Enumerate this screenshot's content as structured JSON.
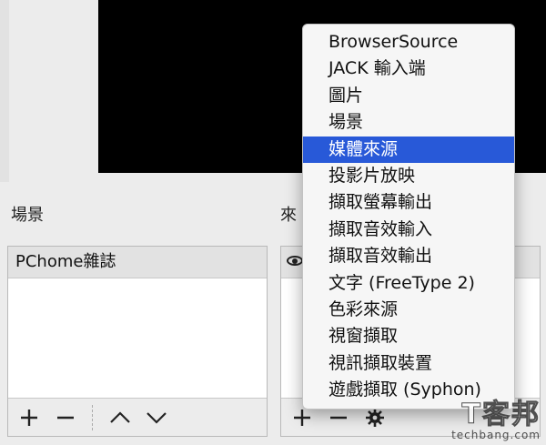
{
  "scenes": {
    "title": "場景",
    "items": [
      "PChome雜誌"
    ]
  },
  "sources": {
    "title_partial": "來",
    "toolbar": {}
  },
  "context_menu": {
    "items": [
      "BrowserSource",
      "JACK 輸入端",
      "圖片",
      "場景",
      "媒體來源",
      "投影片放映",
      "擷取螢幕輸出",
      "擷取音效輸入",
      "擷取音效輸出",
      "文字 (FreeType 2)",
      "色彩來源",
      "視窗擷取",
      "視訊擷取裝置",
      "遊戲擷取 (Syphon)"
    ],
    "selected_index": 4
  },
  "watermark": {
    "big": "T客邦",
    "small": "techbang.com"
  },
  "icons": {
    "add": "plus-icon",
    "remove": "minus-icon",
    "up": "chevron-up-icon",
    "down": "chevron-down-icon",
    "settings": "gear-icon",
    "visibility": "eye-icon"
  },
  "colors": {
    "selection": "#2859d8",
    "preview_bg": "#000000",
    "window_bg": "#ececec"
  }
}
